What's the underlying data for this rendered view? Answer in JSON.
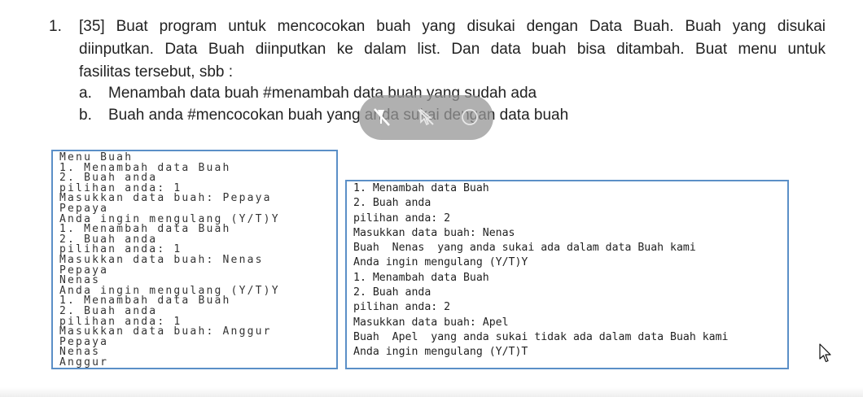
{
  "question": {
    "number": "1.",
    "lines": [
      "[35] Buat program untuk mencocokan buah yang disukai dengan Data Buah. Buah yang disukai",
      "diinputkan. Data Buah diinputkan ke dalam list. Dan data buah bisa ditambah. Buat menu untuk",
      "fasilitas tersebut, sbb :"
    ],
    "items": [
      {
        "letter": "a.",
        "text": "Menambah data buah #menambah data buah yang sudah ada"
      },
      {
        "letter": "b.",
        "text": "Buah anda  #mencocokan buah yang anda sukai dengan data buah"
      }
    ]
  },
  "overlay": {
    "icons": [
      "pen-off-icon",
      "pointer-off-icon",
      "circle-icon"
    ]
  },
  "left_console": {
    "lines": [
      "Menu Buah",
      "1. Menambah data Buah",
      "2. Buah anda",
      "pilihan anda: 1",
      "Masukkan data buah: Pepaya",
      "Pepaya",
      "Anda ingin mengulang (Y/T)Y",
      "1. Menambah data Buah",
      "2. Buah anda",
      "pilihan anda: 1",
      "Masukkan data buah: Nenas",
      "Pepaya",
      "Nenas",
      "Anda ingin mengulang (Y/T)Y",
      "1. Menambah data Buah",
      "2. Buah anda",
      "pilihan anda: 1",
      "Masukkan data buah: Anggur",
      "Pepaya",
      "Nenas",
      "Anggur"
    ]
  },
  "right_console": {
    "lines": [
      "1. Menambah data Buah",
      "2. Buah anda",
      "pilihan anda: 2",
      "Masukkan data buah: Nenas",
      "Buah  Nenas  yang anda sukai ada dalam data Buah kami",
      "Anda ingin mengulang (Y/T)Y",
      "1. Menambah data Buah",
      "2. Buah anda",
      "pilihan anda: 2",
      "Masukkan data buah: Apel",
      "Buah  Apel  yang anda sukai tidak ada dalam data Buah kami",
      "Anda ingin mengulang (Y/T)T"
    ]
  }
}
